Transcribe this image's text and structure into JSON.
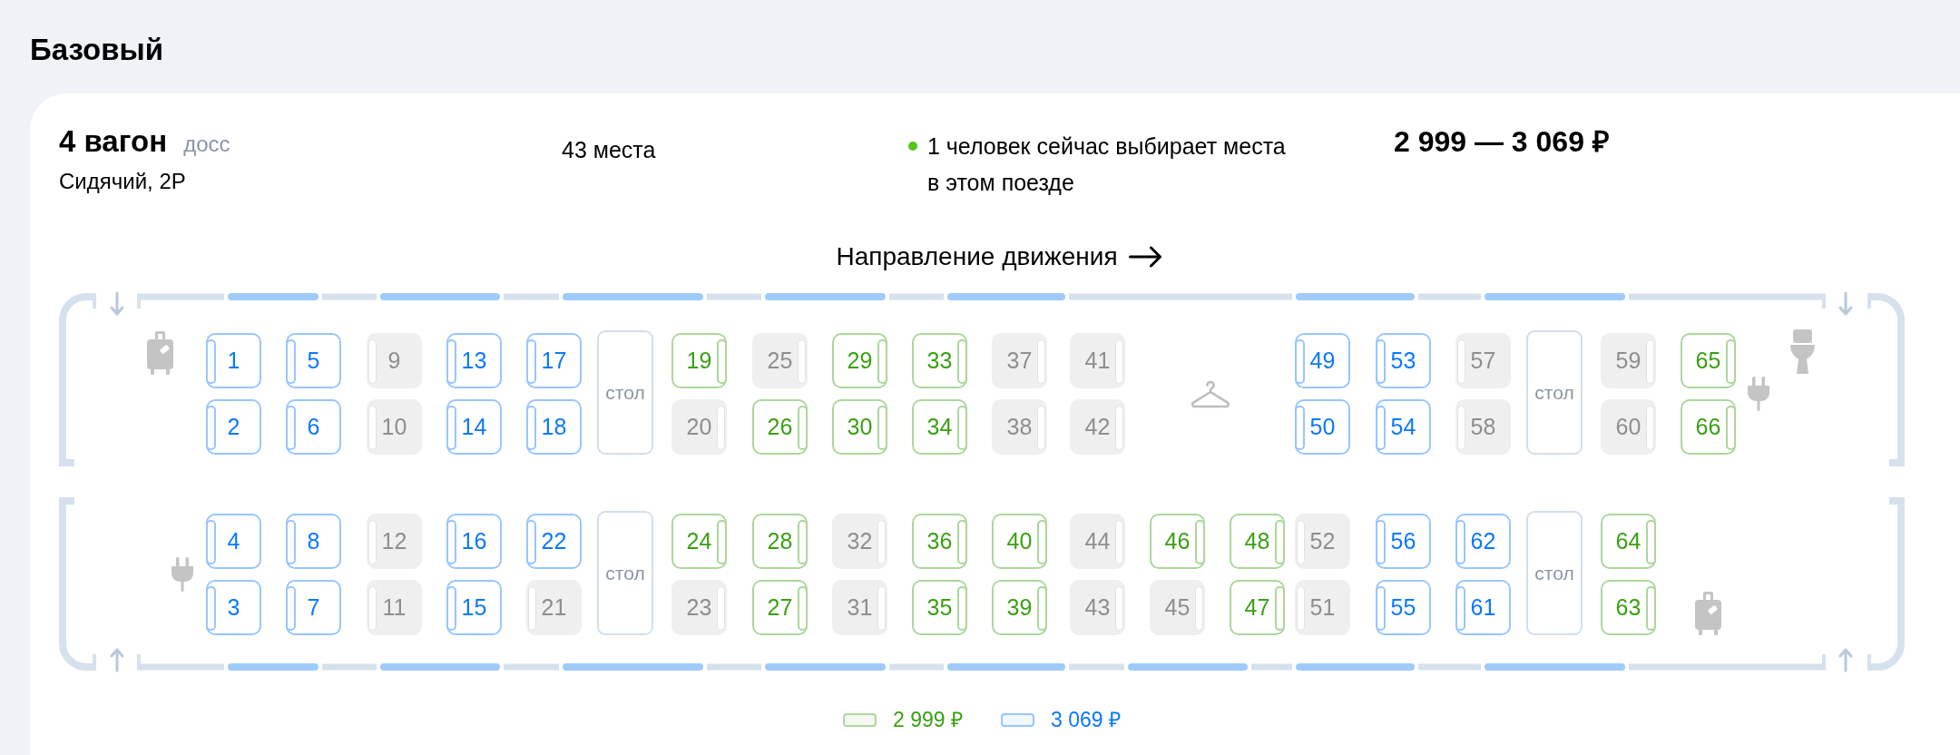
{
  "title": "Базовый",
  "car": {
    "name": "4 вагон",
    "class_code": "досс",
    "type": "Сидячий, 2Р",
    "free_seats": "43 места",
    "viewers_note": "1 человек сейчас выбирает места в этом поезде",
    "price_range": "2 999 — 3 069 ₽"
  },
  "direction": {
    "label": "Направление движения"
  },
  "seat_map": {
    "halves": [
      {
        "slots": [
          {
            "kind": "luggage"
          },
          {
            "kind": "seats",
            "seats": [
              {
                "number": "1",
                "taken": false,
                "color": "#0a78ff",
                "backrest_right": false
              },
              {
                "number": "2",
                "taken": false,
                "color": "#0a78ff",
                "backrest_right": false
              }
            ]
          },
          {
            "kind": "seats",
            "seats": [
              {
                "number": "5",
                "taken": false,
                "color": "#0a78ff",
                "backrest_right": false
              },
              {
                "number": "6",
                "taken": false,
                "color": "#0a78ff",
                "backrest_right": false
              }
            ]
          },
          {
            "kind": "seats",
            "seats": [
              {
                "number": "9",
                "taken": true,
                "backrest_right": false
              },
              {
                "number": "10",
                "taken": true,
                "backrest_right": false
              }
            ]
          },
          {
            "kind": "seats",
            "seats": [
              {
                "number": "13",
                "taken": false,
                "color": "#0a78ff",
                "backrest_right": false
              },
              {
                "number": "14",
                "taken": false,
                "color": "#0a78ff",
                "backrest_right": false
              }
            ]
          },
          {
            "kind": "seats",
            "seats": [
              {
                "number": "17",
                "taken": false,
                "color": "#0a78ff",
                "backrest_right": false
              },
              {
                "number": "18",
                "taken": false,
                "color": "#0a78ff",
                "backrest_right": false
              }
            ]
          },
          {
            "kind": "table",
            "label": "стол"
          },
          {
            "kind": "seats",
            "seats": [
              {
                "number": "19",
                "taken": false,
                "color": "#3aa013",
                "backrest_right": true
              },
              {
                "number": "20",
                "taken": true,
                "backrest_right": true
              }
            ]
          },
          {
            "kind": "seats",
            "seats": [
              {
                "number": "25",
                "taken": true,
                "backrest_right": true
              },
              {
                "number": "26",
                "taken": false,
                "color": "#3aa013",
                "backrest_right": true
              }
            ]
          },
          {
            "kind": "seats",
            "seats": [
              {
                "number": "29",
                "taken": false,
                "color": "#3aa013",
                "backrest_right": true
              },
              {
                "number": "30",
                "taken": false,
                "color": "#3aa013",
                "backrest_right": true
              }
            ]
          },
          {
            "kind": "seats",
            "seats": [
              {
                "number": "33",
                "taken": false,
                "color": "#3aa013",
                "backrest_right": true
              },
              {
                "number": "34",
                "taken": false,
                "color": "#3aa013",
                "backrest_right": true
              }
            ]
          },
          {
            "kind": "seats",
            "seats": [
              {
                "number": "37",
                "taken": true,
                "backrest_right": true
              },
              {
                "number": "38",
                "taken": true,
                "backrest_right": true
              }
            ]
          },
          {
            "kind": "seats",
            "seats": [
              {
                "number": "41",
                "taken": true,
                "backrest_right": true
              },
              {
                "number": "42",
                "taken": true,
                "backrest_right": true
              }
            ]
          },
          {
            "kind": "hanger"
          },
          {
            "kind": "seats",
            "seats": [
              {
                "number": "49",
                "taken": false,
                "color": "#0a78ff",
                "backrest_right": false
              },
              {
                "number": "50",
                "taken": false,
                "color": "#0a78ff",
                "backrest_right": false
              }
            ]
          },
          {
            "kind": "seats",
            "seats": [
              {
                "number": "53",
                "taken": false,
                "color": "#0a78ff",
                "backrest_right": false
              },
              {
                "number": "54",
                "taken": false,
                "color": "#0a78ff",
                "backrest_right": false
              }
            ]
          },
          {
            "kind": "seats",
            "seats": [
              {
                "number": "57",
                "taken": true,
                "backrest_right": false
              },
              {
                "number": "58",
                "taken": true,
                "backrest_right": false
              }
            ]
          },
          {
            "kind": "table",
            "label": "стол"
          },
          {
            "kind": "seats",
            "seats": [
              {
                "number": "59",
                "taken": true,
                "backrest_right": true
              },
              {
                "number": "60",
                "taken": true,
                "backrest_right": true
              }
            ]
          },
          {
            "kind": "seats",
            "seats": [
              {
                "number": "65",
                "taken": false,
                "color": "#3aa013",
                "backrest_right": true
              },
              {
                "number": "66",
                "taken": false,
                "color": "#3aa013",
                "backrest_right": true
              }
            ]
          },
          {
            "kind": "plug"
          },
          {
            "kind": "toilet"
          }
        ]
      },
      {
        "slots": [
          {
            "kind": "plug"
          },
          {
            "kind": "seats",
            "seats": [
              {
                "number": "4",
                "taken": false,
                "color": "#0a78ff",
                "backrest_right": false
              },
              {
                "number": "3",
                "taken": false,
                "color": "#0a78ff",
                "backrest_right": false
              }
            ]
          },
          {
            "kind": "seats",
            "seats": [
              {
                "number": "8",
                "taken": false,
                "color": "#0a78ff",
                "backrest_right": false
              },
              {
                "number": "7",
                "taken": false,
                "color": "#0a78ff",
                "backrest_right": false
              }
            ]
          },
          {
            "kind": "seats",
            "seats": [
              {
                "number": "12",
                "taken": true,
                "backrest_right": false
              },
              {
                "number": "11",
                "taken": true,
                "backrest_right": false
              }
            ]
          },
          {
            "kind": "seats",
            "seats": [
              {
                "number": "16",
                "taken": false,
                "color": "#0a78ff",
                "backrest_right": false
              },
              {
                "number": "15",
                "taken": false,
                "color": "#0a78ff",
                "backrest_right": false
              }
            ]
          },
          {
            "kind": "seats",
            "seats": [
              {
                "number": "22",
                "taken": false,
                "color": "#0a78ff",
                "backrest_right": false
              },
              {
                "number": "21",
                "taken": true,
                "backrest_right": false
              }
            ]
          },
          {
            "kind": "table",
            "label": "стол"
          },
          {
            "kind": "seats",
            "seats": [
              {
                "number": "24",
                "taken": false,
                "color": "#3aa013",
                "backrest_right": true
              },
              {
                "number": "23",
                "taken": true,
                "backrest_right": true
              }
            ]
          },
          {
            "kind": "seats",
            "seats": [
              {
                "number": "28",
                "taken": false,
                "color": "#3aa013",
                "backrest_right": true
              },
              {
                "number": "27",
                "taken": false,
                "color": "#3aa013",
                "backrest_right": true
              }
            ]
          },
          {
            "kind": "seats",
            "seats": [
              {
                "number": "32",
                "taken": true,
                "backrest_right": true
              },
              {
                "number": "31",
                "taken": true,
                "backrest_right": true
              }
            ]
          },
          {
            "kind": "seats",
            "seats": [
              {
                "number": "36",
                "taken": false,
                "color": "#3aa013",
                "backrest_right": true
              },
              {
                "number": "35",
                "taken": false,
                "color": "#3aa013",
                "backrest_right": true
              }
            ]
          },
          {
            "kind": "seats",
            "seats": [
              {
                "number": "40",
                "taken": false,
                "color": "#3aa013",
                "backrest_right": true
              },
              {
                "number": "39",
                "taken": false,
                "color": "#3aa013",
                "backrest_right": true
              }
            ]
          },
          {
            "kind": "seats",
            "seats": [
              {
                "number": "44",
                "taken": true,
                "backrest_right": true
              },
              {
                "number": "43",
                "taken": true,
                "backrest_right": true
              }
            ]
          },
          {
            "kind": "seats",
            "seats": [
              {
                "number": "46",
                "taken": false,
                "color": "#3aa013",
                "backrest_right": true
              },
              {
                "number": "45",
                "taken": true,
                "backrest_right": true
              }
            ]
          },
          {
            "kind": "seats",
            "seats": [
              {
                "number": "48",
                "taken": false,
                "color": "#3aa013",
                "backrest_right": true
              },
              {
                "number": "47",
                "taken": false,
                "color": "#3aa013",
                "backrest_right": true
              }
            ]
          },
          {
            "kind": "seats",
            "seats": [
              {
                "number": "52",
                "taken": true,
                "backrest_right": false
              },
              {
                "number": "51",
                "taken": true,
                "backrest_right": false
              }
            ]
          },
          {
            "kind": "seats",
            "seats": [
              {
                "number": "56",
                "taken": false,
                "color": "#0a78ff",
                "backrest_right": false
              },
              {
                "number": "55",
                "taken": false,
                "color": "#0a78ff",
                "backrest_right": false
              }
            ]
          },
          {
            "kind": "seats",
            "seats": [
              {
                "number": "62",
                "taken": false,
                "color": "#0a78ff",
                "backrest_right": false
              },
              {
                "number": "61",
                "taken": false,
                "color": "#0a78ff",
                "backrest_right": false
              }
            ]
          },
          {
            "kind": "table",
            "label": "стол"
          },
          {
            "kind": "seats",
            "seats": [
              {
                "number": "64",
                "taken": false,
                "color": "#3aa013",
                "backrest_right": true
              },
              {
                "number": "63",
                "taken": false,
                "color": "#3aa013",
                "backrest_right": true
              }
            ]
          },
          {
            "kind": "luggage"
          }
        ]
      }
    ]
  },
  "legend": [
    {
      "price": "2 999 ₽",
      "color": "#3aa013"
    },
    {
      "price": "3 069 ₽",
      "color": "#0a78ff"
    }
  ]
}
